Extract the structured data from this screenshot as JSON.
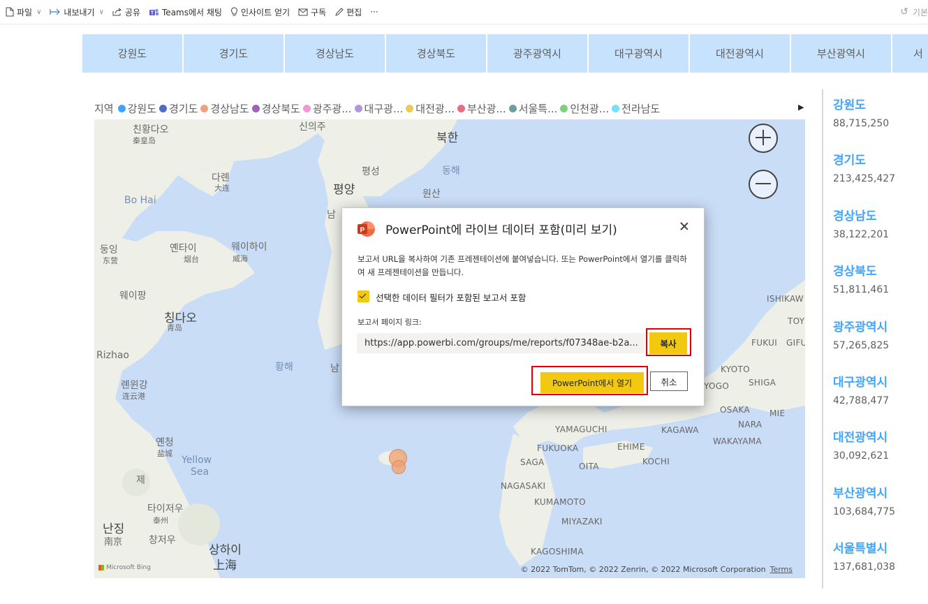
{
  "toolbar": {
    "file": "파일",
    "export": "내보내기",
    "share": "공유",
    "teams": "Teams에서 채팅",
    "insights": "인사이트 얻기",
    "subscribe": "구독",
    "edit": "편집",
    "more": "···",
    "right_label": "기본"
  },
  "slicer": {
    "items": [
      "강원도",
      "경기도",
      "경상남도",
      "경상북도",
      "광주광역시",
      "대구광역시",
      "대전광역시",
      "부산광역시",
      "서"
    ]
  },
  "legend": {
    "title": "지역",
    "items": [
      {
        "label": "강원도",
        "color": "#41a4ff"
      },
      {
        "label": "경기도",
        "color": "#4f6bc3"
      },
      {
        "label": "경상남도",
        "color": "#f2a07b"
      },
      {
        "label": "경상북도",
        "color": "#a061b6"
      },
      {
        "label": "광주광...",
        "color": "#f197d2"
      },
      {
        "label": "대구광...",
        "color": "#b097e0"
      },
      {
        "label": "대전광...",
        "color": "#e8cc55"
      },
      {
        "label": "부산광...",
        "color": "#e36e82"
      },
      {
        "label": "서울특...",
        "color": "#6e9d9c"
      },
      {
        "label": "인천광...",
        "color": "#7ed07f"
      },
      {
        "label": "전라남도",
        "color": "#76e0f7"
      }
    ]
  },
  "map": {
    "labels": {
      "north_korea": "북한",
      "east_sea": "동해",
      "yellow_sea_kr": "황해",
      "yellow_sea": "Yellow",
      "yellow_sea2": "Sea",
      "bo_hai": "Bo Hai",
      "rizhao": "Rizhao",
      "pyongsong": "평성",
      "pyongyang": "평양",
      "wonsan": "원산",
      "sinuiju": "신의주",
      "dalian": "다롄",
      "dalian_cn": "大连",
      "huludao": "친황다오",
      "huludao_cn": "秦皇岛",
      "dongying": "둥잉",
      "dongying_cn": "东营",
      "yantai": "옌타이",
      "yantai_cn": "烟台",
      "weihai": "웨이하이",
      "weihai_cn": "威海",
      "weifang": "웨이팡",
      "qingdao": "칭다오",
      "qingdao_cn": "青岛",
      "lianyungang": "롄윈강",
      "lianyungang_cn": "连云港",
      "yancheng": "옌청",
      "yancheng_cn": "盐城",
      "taizhou": "타이저우",
      "taizhou_cn": "泰州",
      "nanjing": "난징",
      "nanjing_cn": "南京",
      "changzhou": "창저우",
      "shanghai": "상하이",
      "shanghai_cn": "上海",
      "jeju": "제",
      "south": "남",
      "ishikawa": "ISHIKAW",
      "toyama": "TOY",
      "fukui": "FUKUI",
      "gifu": "GIFU",
      "kyoto": "KYOTO",
      "shiga": "SHIGA",
      "hyogo": "YOGO",
      "osaka": "OSAKA",
      "mie": "MIE",
      "nara": "NARA",
      "wakayama": "WAKAYAMA",
      "yamaguchi": "YAMAGUCHI",
      "kagawa": "KAGAWA",
      "fukuoka": "FUKUOKA",
      "ehime": "EHIME",
      "saga": "SAGA",
      "oita": "OITA",
      "kochi": "KOCHI",
      "nagasaki": "NAGASAKI",
      "kumamoto": "KUMAMOTO",
      "miyazaki": "MIYAZAKI",
      "kagoshima": "KAGOSHIMA"
    },
    "attribution": "© 2022 TomTom, © 2022 Zenrin, © 2022 Microsoft Corporation",
    "terms": "Terms",
    "bing": "Microsoft Bing"
  },
  "cards": [
    {
      "name": "강원도",
      "value": "88,715,250"
    },
    {
      "name": "경기도",
      "value": "213,425,427"
    },
    {
      "name": "경상남도",
      "value": "38,122,201"
    },
    {
      "name": "경상북도",
      "value": "51,811,461"
    },
    {
      "name": "광주광역시",
      "value": "57,265,825"
    },
    {
      "name": "대구광역시",
      "value": "42,788,477"
    },
    {
      "name": "대전광역시",
      "value": "30,092,621"
    },
    {
      "name": "부산광역시",
      "value": "103,684,775"
    },
    {
      "name": "서울특별시",
      "value": "137,681,038"
    }
  ],
  "dialog": {
    "title": "PowerPoint에 라이브 데이터 포함(미리 보기)",
    "description": "보고서 URL을 복사하여 기존 프레젠테이션에 붙여넣습니다. 또는 PowerPoint에서 열기를 클릭하여 새 프레젠테이션을 만듭니다.",
    "checkbox_label": "선택한 데이터 필터가 포함된 보고서 포함",
    "checkbox_checked": true,
    "link_label": "보고서 페이지 링크:",
    "url": "https://app.powerbi.com/groups/me/reports/f07348ae-b2a...",
    "copy_button": "복사",
    "open_button": "PowerPoint에서 열기",
    "cancel_button": "취소",
    "accent_color": "#f2c811",
    "highlight_color": "#e10000"
  }
}
